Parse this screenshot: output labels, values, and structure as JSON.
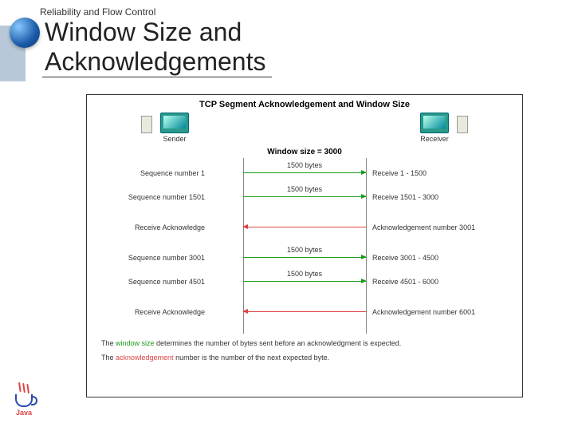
{
  "breadcrumb": "Reliability and Flow Control",
  "title_line1": "Window Size and",
  "title_line2": "Acknowledgements",
  "diagram": {
    "title": "TCP Segment Acknowledgement and Window Size",
    "sender_label": "Sender",
    "receiver_label": "Receiver",
    "window_label": "Window size = 3000",
    "rows": [
      {
        "type": "right",
        "bytes": "1500 bytes",
        "left": "Sequence number 1",
        "right": "Receive 1 - 1500"
      },
      {
        "type": "right",
        "bytes": "1500 bytes",
        "left": "Sequence number 1501",
        "right": "Receive 1501 - 3000"
      },
      {
        "type": "left",
        "bytes": "",
        "left": "Receive Acknowledge",
        "right": "Acknowledgement number 3001"
      },
      {
        "type": "right",
        "bytes": "1500 bytes",
        "left": "Sequence number 3001",
        "right": "Receive 3001 - 4500"
      },
      {
        "type": "right",
        "bytes": "1500 bytes",
        "left": "Sequence number 4501",
        "right": "Receive 4501 - 6000"
      },
      {
        "type": "left",
        "bytes": "",
        "left": "Receive Acknowledge",
        "right": "Acknowledgement number 6001"
      }
    ],
    "footer1_pre": "The ",
    "footer1_hl": "window size",
    "footer1_post": " determines the number of bytes sent before an acknowledgment is expected.",
    "footer2_pre": "The ",
    "footer2_hl": "acknowledgement",
    "footer2_post": " number is the number of the next expected byte."
  },
  "java_label": "Java"
}
